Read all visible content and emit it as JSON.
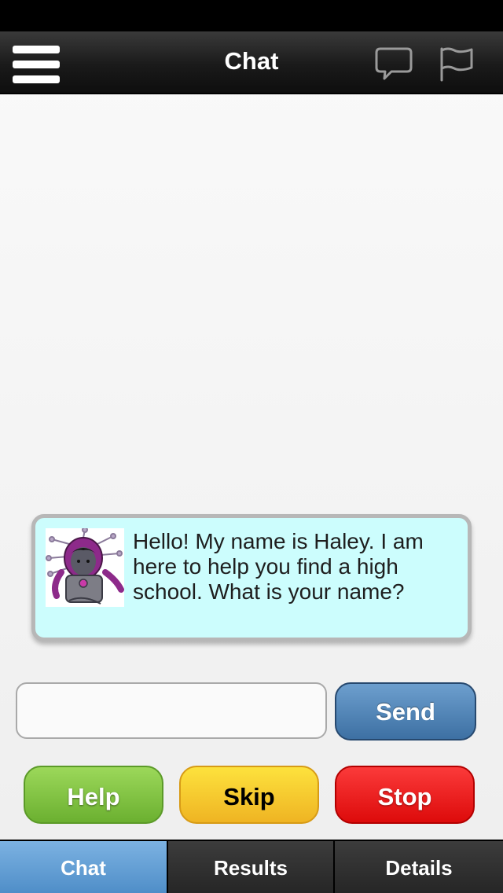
{
  "nav": {
    "title": "Chat",
    "icons": [
      "menu-icon",
      "speech-bubble-icon",
      "flag-icon"
    ]
  },
  "chat": {
    "messages": [
      {
        "sender_avatar": "robot-avatar",
        "text": "Hello! My name is Haley. I am here to help you find a high school. What is your name?"
      }
    ]
  },
  "composer": {
    "input_value": "",
    "input_placeholder": "",
    "send_label": "Send"
  },
  "actions": {
    "help_label": "Help",
    "skip_label": "Skip",
    "stop_label": "Stop"
  },
  "tabs": [
    {
      "label": "Chat",
      "active": true
    },
    {
      "label": "Results",
      "active": false
    },
    {
      "label": "Details",
      "active": false
    }
  ],
  "colors": {
    "bubble_bg": "#ccfdfd",
    "send": "#4a7fb3",
    "help": "#7cc13f",
    "skip": "#f5c82a",
    "stop": "#e81818",
    "active_tab": "#5d9bd3"
  }
}
